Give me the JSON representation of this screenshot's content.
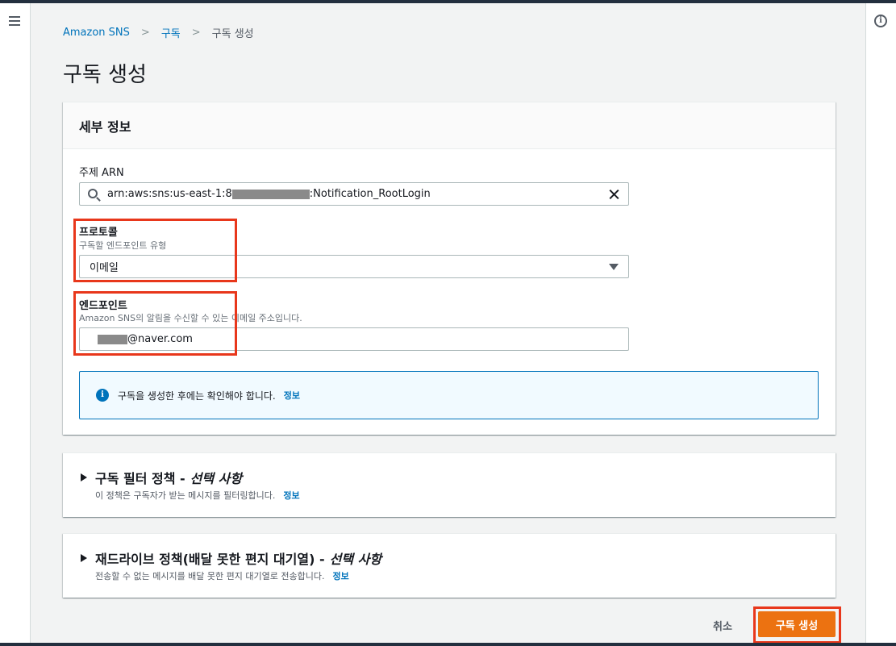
{
  "breadcrumb": {
    "items": [
      "Amazon SNS",
      "구독",
      "구독 생성"
    ],
    "separator": ">"
  },
  "page_title": "구독 생성",
  "details": {
    "header": "세부 정보",
    "topic_arn": {
      "label": "주제 ARN",
      "value_prefix": "arn:aws:sns:us-east-1:8",
      "value_suffix": ":Notification_RootLogin"
    },
    "protocol": {
      "label": "프로토콜",
      "description": "구독할 엔드포인트 유형",
      "selected": "이메일"
    },
    "endpoint": {
      "label": "엔드포인트",
      "description": "Amazon SNS의 알림을 수신할 수 있는 이메일 주소입니다.",
      "value": "@naver.com"
    },
    "alert": {
      "text": "구독을 생성한 후에는 확인해야 합니다.",
      "link": "정보"
    }
  },
  "filter_policy": {
    "title": "구독 필터 정책 -",
    "optional": "선택 사항",
    "description": "이 정책은 구독자가 받는 메시지를 필터링합니다.",
    "link": "정보"
  },
  "redrive_policy": {
    "title": "재드라이브 정책(배달 못한 편지 대기열) -",
    "optional": "선택 사항",
    "description": "전송할 수 없는 메시지를 배달 못한 편지 대기열로 전송합니다.",
    "link": "정보"
  },
  "actions": {
    "cancel": "취소",
    "create": "구독 생성"
  },
  "colors": {
    "accent": "#0073bb",
    "primary_button": "#ec7211",
    "highlight_box": "#e8371b",
    "top_bar": "#232f3e"
  }
}
